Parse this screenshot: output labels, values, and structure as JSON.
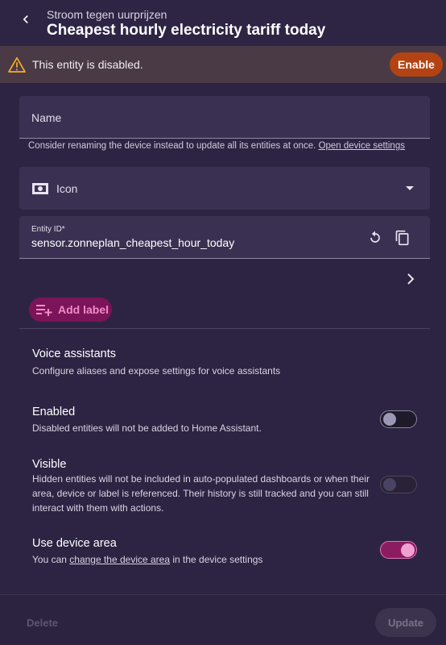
{
  "header": {
    "subtitle": "Stroom tegen uurprijzen",
    "title": "Cheapest hourly electricity tariff today"
  },
  "alert": {
    "message": "This entity is disabled.",
    "enable_label": "Enable"
  },
  "form": {
    "name_label": "Name",
    "name_helper": "Consider renaming the device instead to update all its entities at once.",
    "name_helper_link": "Open device settings",
    "icon_label": "Icon",
    "entity_id_label": "Entity ID*",
    "entity_id_value": "sensor.zonneplan_cheapest_hour_today",
    "add_label": "Add label"
  },
  "voice": {
    "title": "Voice assistants",
    "desc": "Configure aliases and expose settings for voice assistants"
  },
  "enabled": {
    "title": "Enabled",
    "desc": "Disabled entities will not be added to Home Assistant.",
    "state": "off"
  },
  "visible": {
    "title": "Visible",
    "desc": "Hidden entities will not be included in auto-populated dashboards or when their area, device or label is referenced. Their history is still tracked and you can still interact with them with actions.",
    "state": "disabled"
  },
  "area": {
    "title": "Use device area",
    "desc_prefix": "You can ",
    "desc_link": "change the device area",
    "desc_suffix": " in the device settings",
    "state": "on"
  },
  "footer": {
    "delete_label": "Delete",
    "update_label": "Update"
  },
  "colors": {
    "accent": "#7b1458",
    "warning": "#b34312",
    "background": "#2b2340"
  },
  "icons": [
    "back-arrow-icon",
    "warning-icon",
    "money-icon",
    "dropdown-arrow-icon",
    "reset-icon",
    "copy-icon",
    "add-label-icon",
    "chevron-right-icon"
  ]
}
